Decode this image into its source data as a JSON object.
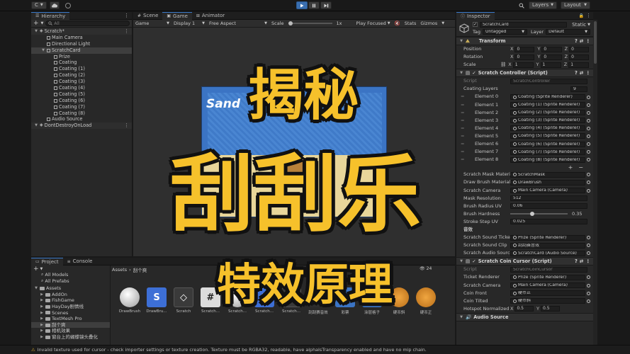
{
  "toolbar": {
    "account": "C",
    "layers": "Layers",
    "layout": "Layout"
  },
  "hierarchy": {
    "tab": "Hierarchy",
    "search_placeholder": "All",
    "items": [
      {
        "label": "Scratch*",
        "depth": 0,
        "kind": "scene"
      },
      {
        "label": "Main Camera",
        "depth": 1,
        "kind": "obj"
      },
      {
        "label": "Directional Light",
        "depth": 1,
        "kind": "obj"
      },
      {
        "label": "ScratchCard",
        "depth": 1,
        "kind": "parent"
      },
      {
        "label": "Prize",
        "depth": 2,
        "kind": "obj"
      },
      {
        "label": "Coating",
        "depth": 2,
        "kind": "obj"
      },
      {
        "label": "Coating (1)",
        "depth": 2,
        "kind": "obj"
      },
      {
        "label": "Coating (2)",
        "depth": 2,
        "kind": "obj"
      },
      {
        "label": "Coating (3)",
        "depth": 2,
        "kind": "obj"
      },
      {
        "label": "Coating (4)",
        "depth": 2,
        "kind": "obj"
      },
      {
        "label": "Coating (5)",
        "depth": 2,
        "kind": "obj"
      },
      {
        "label": "Coating (6)",
        "depth": 2,
        "kind": "obj"
      },
      {
        "label": "Coating (7)",
        "depth": 2,
        "kind": "obj"
      },
      {
        "label": "Coating (8)",
        "depth": 2,
        "kind": "obj"
      },
      {
        "label": "Audio Source",
        "depth": 1,
        "kind": "obj"
      },
      {
        "label": "DontDestroyOnLoad",
        "depth": 0,
        "kind": "scene"
      }
    ]
  },
  "center": {
    "tabs": [
      "Scene",
      "Game",
      "Animator"
    ],
    "game_label": "Game",
    "display": "Display 1",
    "aspect": "Free Aspect",
    "scale_label": "Scale",
    "scale_value": "1x",
    "play_focused": "Play Focused",
    "stats": "Stats",
    "gizmos": "Gizmos",
    "game_art_text": "Sand"
  },
  "inspector": {
    "tab": "Inspector",
    "object_name": "ScratchCard",
    "static": "Static",
    "tag_label": "Tag",
    "tag_value": "Untagged",
    "layer_label": "Layer",
    "layer_value": "Default",
    "transform": {
      "title": "Transform",
      "rows": [
        {
          "label": "Position",
          "x": "0",
          "y": "0",
          "z": "0"
        },
        {
          "label": "Rotation",
          "x": "0",
          "y": "0",
          "z": "0"
        },
        {
          "label": "Scale",
          "x": "1",
          "y": "1",
          "z": "1"
        }
      ]
    },
    "scratch_controller": {
      "title": "Scratch Controller (Script)",
      "script_label": "Script",
      "script_value": "ScratchController",
      "coating_label": "Coating Layers",
      "coating_count": "9",
      "elements": [
        {
          "label": "Element 0",
          "value": "Coating (Sprite Renderer)"
        },
        {
          "label": "Element 1",
          "value": "Coating (1) (Sprite Renderer)"
        },
        {
          "label": "Element 2",
          "value": "Coating (2) (Sprite Renderer)"
        },
        {
          "label": "Element 3",
          "value": "Coating (3) (Sprite Renderer)"
        },
        {
          "label": "Element 4",
          "value": "Coating (4) (Sprite Renderer)"
        },
        {
          "label": "Element 5",
          "value": "Coating (5) (Sprite Renderer)"
        },
        {
          "label": "Element 6",
          "value": "Coating (6) (Sprite Renderer)"
        },
        {
          "label": "Element 7",
          "value": "Coating (7) (Sprite Renderer)"
        },
        {
          "label": "Element 8",
          "value": "Coating (8) (Sprite Renderer)"
        }
      ],
      "fields": [
        {
          "label": "Scratch Mask Materi",
          "value": "ScratchMask"
        },
        {
          "label": "Draw Brush Material",
          "value": "DrawBrush"
        },
        {
          "label": "Scratch Camera",
          "value": "Main Camera (Camera)"
        },
        {
          "label": "Mask Resolution",
          "value": "512"
        },
        {
          "label": "Brush Radius UV",
          "value": "0.06"
        },
        {
          "label": "Brush Hardness",
          "value": "0.35",
          "slider": 0.35
        },
        {
          "label": "Stroke Step UV",
          "value": "0.025"
        }
      ],
      "sound_header": "音效",
      "sound_fields": [
        {
          "label": "Scratch Sound Ticket",
          "value": "Prize (Sprite Renderer)"
        },
        {
          "label": "Scratch Sound Clip",
          "value": "刮刮赛音效"
        },
        {
          "label": "Scratch Audio Source",
          "value": "ScratchCard (Audio Source)"
        }
      ]
    },
    "coin_cursor": {
      "title": "Scratch Coin Cursor (Script)",
      "script_label": "Script",
      "script_value": "ScratchCoinCursor",
      "fields": [
        {
          "label": "Ticket Renderer",
          "value": "Prize (Sprite Renderer)"
        },
        {
          "label": "Scratch Camera",
          "value": "Main Camera (Camera)"
        },
        {
          "label": "Coin Front",
          "value": "硬币正"
        },
        {
          "label": "Coin Tilted",
          "value": "硬币斜"
        }
      ],
      "hotspot_label": "Hotspot Normalized",
      "hotspot_x": "0.5",
      "hotspot_y": "0.5"
    },
    "audio_source_title": "Audio Source"
  },
  "project": {
    "tabs": [
      "Project",
      "Console"
    ],
    "favorites": [
      "All Models",
      "All Prefabs"
    ],
    "tree": [
      {
        "label": "Assets",
        "depth": 0
      },
      {
        "label": "AddOn",
        "depth": 1
      },
      {
        "label": "FishGame",
        "depth": 1
      },
      {
        "label": "HayDay剧情线",
        "depth": 1
      },
      {
        "label": "Scenes",
        "depth": 1
      },
      {
        "label": "TextMesh Pro",
        "depth": 1
      },
      {
        "label": "刮个爽",
        "depth": 1
      },
      {
        "label": "相机效果",
        "depth": 1
      },
      {
        "label": "窗台上的蝴蝶镜头叠化",
        "depth": 1
      }
    ],
    "breadcrumb": [
      "Assets",
      "刮个爽"
    ],
    "asset_count": "24",
    "assets": [
      {
        "label": "DrawBrush",
        "kind": "material"
      },
      {
        "label": "DrawBru...",
        "kind": "shader"
      },
      {
        "label": "Scratch",
        "kind": "unity"
      },
      {
        "label": "Scratch...",
        "kind": "script"
      },
      {
        "label": "Scratch...",
        "kind": "material"
      },
      {
        "label": "Scratch...",
        "kind": "shader"
      },
      {
        "label": "Scratch...",
        "kind": "unity"
      },
      {
        "label": "刮刮赛音效",
        "kind": "audio"
      },
      {
        "label": "彩票",
        "kind": "image"
      },
      {
        "label": "涂层格子",
        "kind": "image"
      },
      {
        "label": "硬币斜",
        "kind": "coin"
      },
      {
        "label": "硬币正",
        "kind": "coin"
      }
    ]
  },
  "overlay": {
    "line1": "揭秘",
    "line2": "刮刮乐",
    "line3": "特效原理"
  },
  "status": {
    "message": "Invalid texture used for cursor - check importer settings or texture creation. Texture must be RGBA32, readable, have alphaIsTransparency enabled and have no mip chain."
  },
  "colors": {
    "accent": "#3a79c9",
    "overlay_text": "#f6c12b",
    "game_bg": "#3b74c4"
  }
}
